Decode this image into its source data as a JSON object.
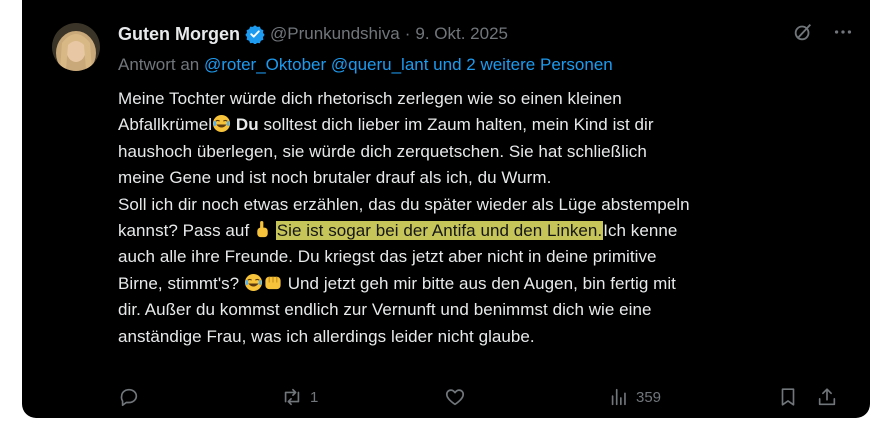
{
  "tweet": {
    "author_name": "Guten Morgen",
    "handle": "@Prunkundshiva",
    "separator": "·",
    "date": "9. Okt. 2025",
    "reply_prefix": "Antwort an",
    "reply_to": "@roter_Oktober @queru_lant und 2 weitere Personen",
    "text": {
      "l1": "Meine Tochter würde dich rhetorisch zerlegen wie so einen kleinen",
      "l2a": "Abfallkrümel",
      "l2b": " Du",
      "l2c": " solltest dich lieber im Zaum halten, mein Kind ist dir",
      "l3": "haushoch überlegen, sie würde dich zerquetschen. Sie hat schließlich",
      "l4": "meine Gene und ist noch brutaler drauf als ich, du Wurm.",
      "l5": "Soll ich dir noch etwas erzählen, das du später wieder als Lüge abstempeln",
      "l6a": "kannst? Pass auf ",
      "l6_highlight": "Sie ist sogar bei der Antifa und den Linken.",
      "l6b": "Ich kenne",
      "l7": "auch alle ihre Freunde. Du kriegst das jetzt aber nicht in deine primitive",
      "l8a": "Birne, stimmt's? ",
      "l8b": " Und jetzt geh mir bitte aus den Augen, bin fertig mit",
      "l9": "dir. Außer du kommst endlich zur Vernunft und benimmst dich wie eine",
      "l10": "anständige Frau, was ich allerdings leider nicht glaube."
    },
    "icons": {
      "emoji_laugh": "laughing-crying-face",
      "emoji_point": "index-pointing-up",
      "emoji_fist": "oncoming-fist"
    }
  },
  "actions": {
    "replies": "",
    "reposts": "1",
    "likes": "",
    "views": "359"
  },
  "colors": {
    "background": "#000000",
    "text": "#e7e9ea",
    "secondary": "#71767b",
    "link": "#1d9bf0",
    "highlight": "#c6c55a"
  }
}
